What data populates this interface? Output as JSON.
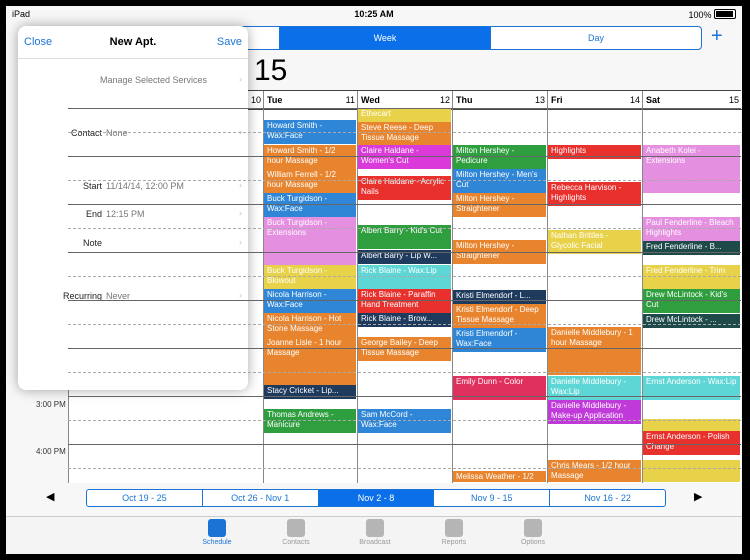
{
  "status": {
    "carrier": "iPad",
    "time": "10:25 AM",
    "battery": "100%"
  },
  "view_tabs": {
    "day_left": "",
    "week": "Week",
    "day": "Day"
  },
  "add_label": "+",
  "month_year": "15",
  "days": [
    {
      "name": "",
      "num": "10"
    },
    {
      "name": "Tue",
      "num": "11"
    },
    {
      "name": "Wed",
      "num": "12"
    },
    {
      "name": "Thu",
      "num": "13"
    },
    {
      "name": "Fri",
      "num": "14"
    },
    {
      "name": "Sat",
      "num": "15"
    }
  ],
  "time_labels": {
    "t1": "3:00 PM",
    "t2": "4:00 PM"
  },
  "appointments": [
    {
      "day": 1,
      "text": "Howard Smith - Wax:Face",
      "color": "#2f86d6",
      "start": 30,
      "len": 24
    },
    {
      "day": 1,
      "text": "Howard Smith - 1/2 hour Massage",
      "color": "#e8842d",
      "start": 55,
      "len": 24
    },
    {
      "day": 1,
      "text": "William Ferrell - 1/2 hour Massage",
      "color": "#e8842d",
      "start": 79,
      "len": 24
    },
    {
      "day": 1,
      "text": "Buck Turgidson - Wax:Face",
      "color": "#2f86d6",
      "start": 103,
      "len": 24
    },
    {
      "day": 1,
      "text": "Buck Turgidson - Extensions",
      "color": "#e58fe0",
      "start": 127,
      "len": 48
    },
    {
      "day": 1,
      "text": "Buck Turgidson - Blowout",
      "color": "#e8d24a",
      "start": 175,
      "len": 24
    },
    {
      "day": 1,
      "text": "Nicola Harrison - Wax:Face",
      "color": "#2f86d6",
      "start": 199,
      "len": 24
    },
    {
      "day": 1,
      "text": "Nicola Harrison - Hot Stone Massage",
      "color": "#e8842d",
      "start": 223,
      "len": 24
    },
    {
      "day": 1,
      "text": "Joanne Lisle - 1 hour Massage",
      "color": "#e8842d",
      "start": 247,
      "len": 48
    },
    {
      "day": 1,
      "text": "Stacy Cricket - Lip...",
      "color": "#1e3b5e",
      "start": 295,
      "len": 14
    },
    {
      "day": 1,
      "text": "Thomas Andrews - Manicure",
      "color": "#2e9e3e",
      "start": 319,
      "len": 24
    },
    {
      "day": 2,
      "text": "Ethecart",
      "color": "#e8d24a",
      "start": 18,
      "len": 14
    },
    {
      "day": 2,
      "text": "Steve Reese - Deep Tissue Massage",
      "color": "#e8842d",
      "start": 32,
      "len": 24
    },
    {
      "day": 2,
      "text": "Claire Haldane - Women's Cut",
      "color": "#d93ad9",
      "start": 55,
      "len": 24
    },
    {
      "day": 2,
      "text": "Claire Haldane - Acrylic Nails",
      "color": "#e8302d",
      "start": 86,
      "len": 24
    },
    {
      "day": 2,
      "text": "Albert Barry - Kid's Cut",
      "color": "#2e9e3e",
      "start": 135,
      "len": 24
    },
    {
      "day": 2,
      "text": "Albert Barry - Lip W...",
      "color": "#1e3b5e",
      "start": 160,
      "len": 14
    },
    {
      "day": 2,
      "text": "Rick Blaine - Wax:Lip",
      "color": "#5fd6d6",
      "start": 175,
      "len": 24
    },
    {
      "day": 2,
      "text": "Rick Blaine - Paraffin Hand Treatment",
      "color": "#e8302d",
      "start": 199,
      "len": 24
    },
    {
      "day": 2,
      "text": "Rick Blaine - Brow...",
      "color": "#1e3b5e",
      "start": 223,
      "len": 14
    },
    {
      "day": 2,
      "text": "George Bailey - Deep Tissue Massage",
      "color": "#e8842d",
      "start": 247,
      "len": 24
    },
    {
      "day": 2,
      "text": "Sam McCord - Wax:Face",
      "color": "#2f86d6",
      "start": 319,
      "len": 24
    },
    {
      "day": 3,
      "text": "Milton Hershey - Pedicure",
      "color": "#2e9e3e",
      "start": 55,
      "len": 24
    },
    {
      "day": 3,
      "text": "Milton Hershey - Men's Cut",
      "color": "#2f86d6",
      "start": 79,
      "len": 24
    },
    {
      "day": 3,
      "text": "Milton Hershey - Straightener",
      "color": "#e8842d",
      "start": 103,
      "len": 24
    },
    {
      "day": 3,
      "text": "Milton Hershey - Straightener",
      "color": "#e8842d",
      "start": 150,
      "len": 24
    },
    {
      "day": 3,
      "text": "Kristi Elmendorf - L...",
      "color": "#1e3b5e",
      "start": 200,
      "len": 14
    },
    {
      "day": 3,
      "text": "Kristi Elmendorf - Deep Tissue Massage",
      "color": "#e8842d",
      "start": 214,
      "len": 24
    },
    {
      "day": 3,
      "text": "Kristi Elmendorf - Wax:Face",
      "color": "#2f86d6",
      "start": 238,
      "len": 24
    },
    {
      "day": 3,
      "text": "Emily Dunn - Color",
      "color": "#e0305e",
      "start": 286,
      "len": 24
    },
    {
      "day": 3,
      "text": "Melissa Weather - 1/2",
      "color": "#e8842d",
      "start": 381,
      "len": 11
    },
    {
      "day": 4,
      "text": "Highlights",
      "color": "#e8302d",
      "start": 55,
      "len": 14
    },
    {
      "day": 4,
      "text": "Rebecca Harvison - Highlights",
      "color": "#e8302d",
      "start": 92,
      "len": 24
    },
    {
      "day": 4,
      "text": "Nathan Brittles - Glycolic Facial",
      "color": "#e8d24a",
      "start": 140,
      "len": 24
    },
    {
      "day": 4,
      "text": "Danielle Middlebury - 1 hour Massage",
      "color": "#e8842d",
      "start": 237,
      "len": 48
    },
    {
      "day": 4,
      "text": "Danielle Middlebury - Wax:Lip",
      "color": "#5fd6d6",
      "start": 286,
      "len": 24
    },
    {
      "day": 4,
      "text": "Danielle Middlebury - Make-up Application",
      "color": "#c03ad9",
      "start": 310,
      "len": 24
    },
    {
      "day": 4,
      "text": "Chris Mears - 1/2 hour Massage",
      "color": "#e8842d",
      "start": 370,
      "len": 22
    },
    {
      "day": 5,
      "text": "Anabeth Kolei - Extensions",
      "color": "#e58fe0",
      "start": 55,
      "len": 48
    },
    {
      "day": 5,
      "text": "Paul Fenderline - Bleach Highlights",
      "color": "#e58fe0",
      "start": 127,
      "len": 24
    },
    {
      "day": 5,
      "text": "Fred Fenderline - B...",
      "color": "#1e4a4a",
      "start": 151,
      "len": 14
    },
    {
      "day": 5,
      "text": "Fred Fenderline - Trim",
      "color": "#e8d24a",
      "start": 175,
      "len": 24
    },
    {
      "day": 5,
      "text": "Drew McLintock - Kid's Cut",
      "color": "#2e9e3e",
      "start": 199,
      "len": 24
    },
    {
      "day": 5,
      "text": "Drew McLintock - ...",
      "color": "#1e4a4a",
      "start": 224,
      "len": 14
    },
    {
      "day": 5,
      "text": "Ernst Anderson - Wax:Lip",
      "color": "#5fd6d6",
      "start": 286,
      "len": 24
    },
    {
      "day": 5,
      "text": "",
      "color": "#e8d24a",
      "start": 329,
      "len": 12
    },
    {
      "day": 5,
      "text": "Ernst Anderson - Polish Change",
      "color": "#e8302d",
      "start": 341,
      "len": 24
    },
    {
      "day": 5,
      "text": "",
      "color": "#e8d24a",
      "start": 370,
      "len": 22
    }
  ],
  "weeks": [
    "Oct 19 - 25",
    "Oct 26 - Nov 1",
    "Nov 2 - 8",
    "Nov 9 - 15",
    "Nov 16 - 22"
  ],
  "nav": {
    "prev": "◀",
    "next": "▶"
  },
  "tabs": [
    "Schedule",
    "Contacts",
    "Broadcast",
    "Reports",
    "Options"
  ],
  "popover": {
    "close": "Close",
    "title": "New Apt.",
    "save": "Save",
    "services": "Manage Selected Services",
    "contact_label": "Contact",
    "contact_value": "None",
    "start_label": "Start",
    "start_value": "11/14/14, 12:00 PM",
    "end_label": "End",
    "end_value": "12:15 PM",
    "note_label": "Note",
    "recurring_label": "Recurring",
    "recurring_value": "Never"
  }
}
